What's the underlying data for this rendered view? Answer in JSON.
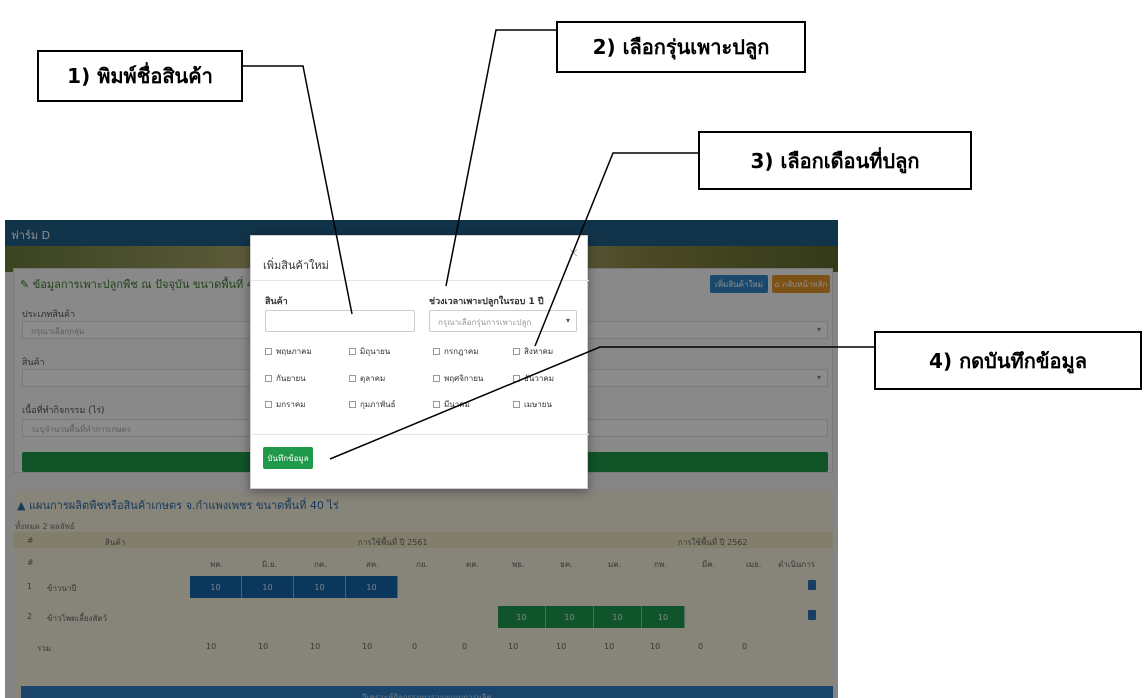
{
  "callouts": {
    "c1": "1) พิมพ์ชื่อสินค้า",
    "c2": "2) เลือกรุ่นเพาะปลูก",
    "c3": "3) เลือกเดือนที่ปลูก",
    "c4": "4) กดบันทึกข้อมูล"
  },
  "app": {
    "nav_title": "ฟาร์ม D",
    "panel1": {
      "title": "ข้อมูลการเพาะปลูกพืช ณ ปัจจุบัน ขนาดพื้นที่ 40 ไร่ จ. กำ",
      "btn_add": "เพิ่มสินค้าใหม่",
      "btn_back": "กลับหน้าหลัก",
      "type_label": "ประเภทสินค้า",
      "type_placeholder": "กรุณาเลือกกลุ่ม",
      "product_label": "สินค้า",
      "area_label": "เนื้อที่ทำกิจกรรม (ไร่)",
      "area_placeholder": "ระบุจำนวนพื้นที่ทำการเกษตร"
    },
    "panel2": {
      "title": "แผนการผลิตพืชหรือสินค้าเกษตร จ.กำแพงเพชร ขนาดพื้นที่ 40 ไร่",
      "subtitle": "ทั้งหมด 2 ผลลัพธ์",
      "col_hash": "#",
      "col_product": "สินค้า",
      "year1": "การใช้พื้นที่ ปี 2561",
      "year2": "การใช้พื้นที่ ปี 2562",
      "months": [
        "พค.",
        "มิ.ย.",
        "กค.",
        "สค.",
        "กย.",
        "ตค.",
        "พย.",
        "ธค.",
        "มค.",
        "กพ.",
        "มีค.",
        "เมย."
      ],
      "action": "ดำเนินการ",
      "rows": [
        {
          "no": "1",
          "name": "ข้าวนาปี",
          "values": [
            "10",
            "10",
            "10",
            "10"
          ]
        },
        {
          "no": "2",
          "name": "ข้าวโพดเลี้ยงสัตว์",
          "values": [
            "10",
            "10",
            "10",
            "10"
          ]
        }
      ],
      "total_label": "รวม",
      "totals": [
        "10",
        "10",
        "10",
        "10",
        "0",
        "0",
        "10",
        "10",
        "10",
        "10",
        "0",
        "0"
      ],
      "bottom_button": "วิเคราะห์กิจกรรมการวางแผนการผลิต"
    }
  },
  "modal": {
    "title": "เพิ่มสินค้าใหม่",
    "close": "×",
    "product_label": "สินค้า",
    "period_label": "ช่วงเวลาเพาะปลูกในรอบ 1 ปี",
    "period_placeholder": "กรุณาเลือกรุ่นการเพาะปลูก",
    "months": [
      "พฤษภาคม",
      "มิถุนายน",
      "กรกฎาคม",
      "สิงหาคม",
      "กันยายน",
      "ตุลาคม",
      "พฤศจิกายน",
      "ธันวาคม",
      "มกราคม",
      "กุมภาพันธ์",
      "มีนาคม",
      "เมษายน"
    ],
    "save_label": "บันทึกข้อมูล"
  }
}
